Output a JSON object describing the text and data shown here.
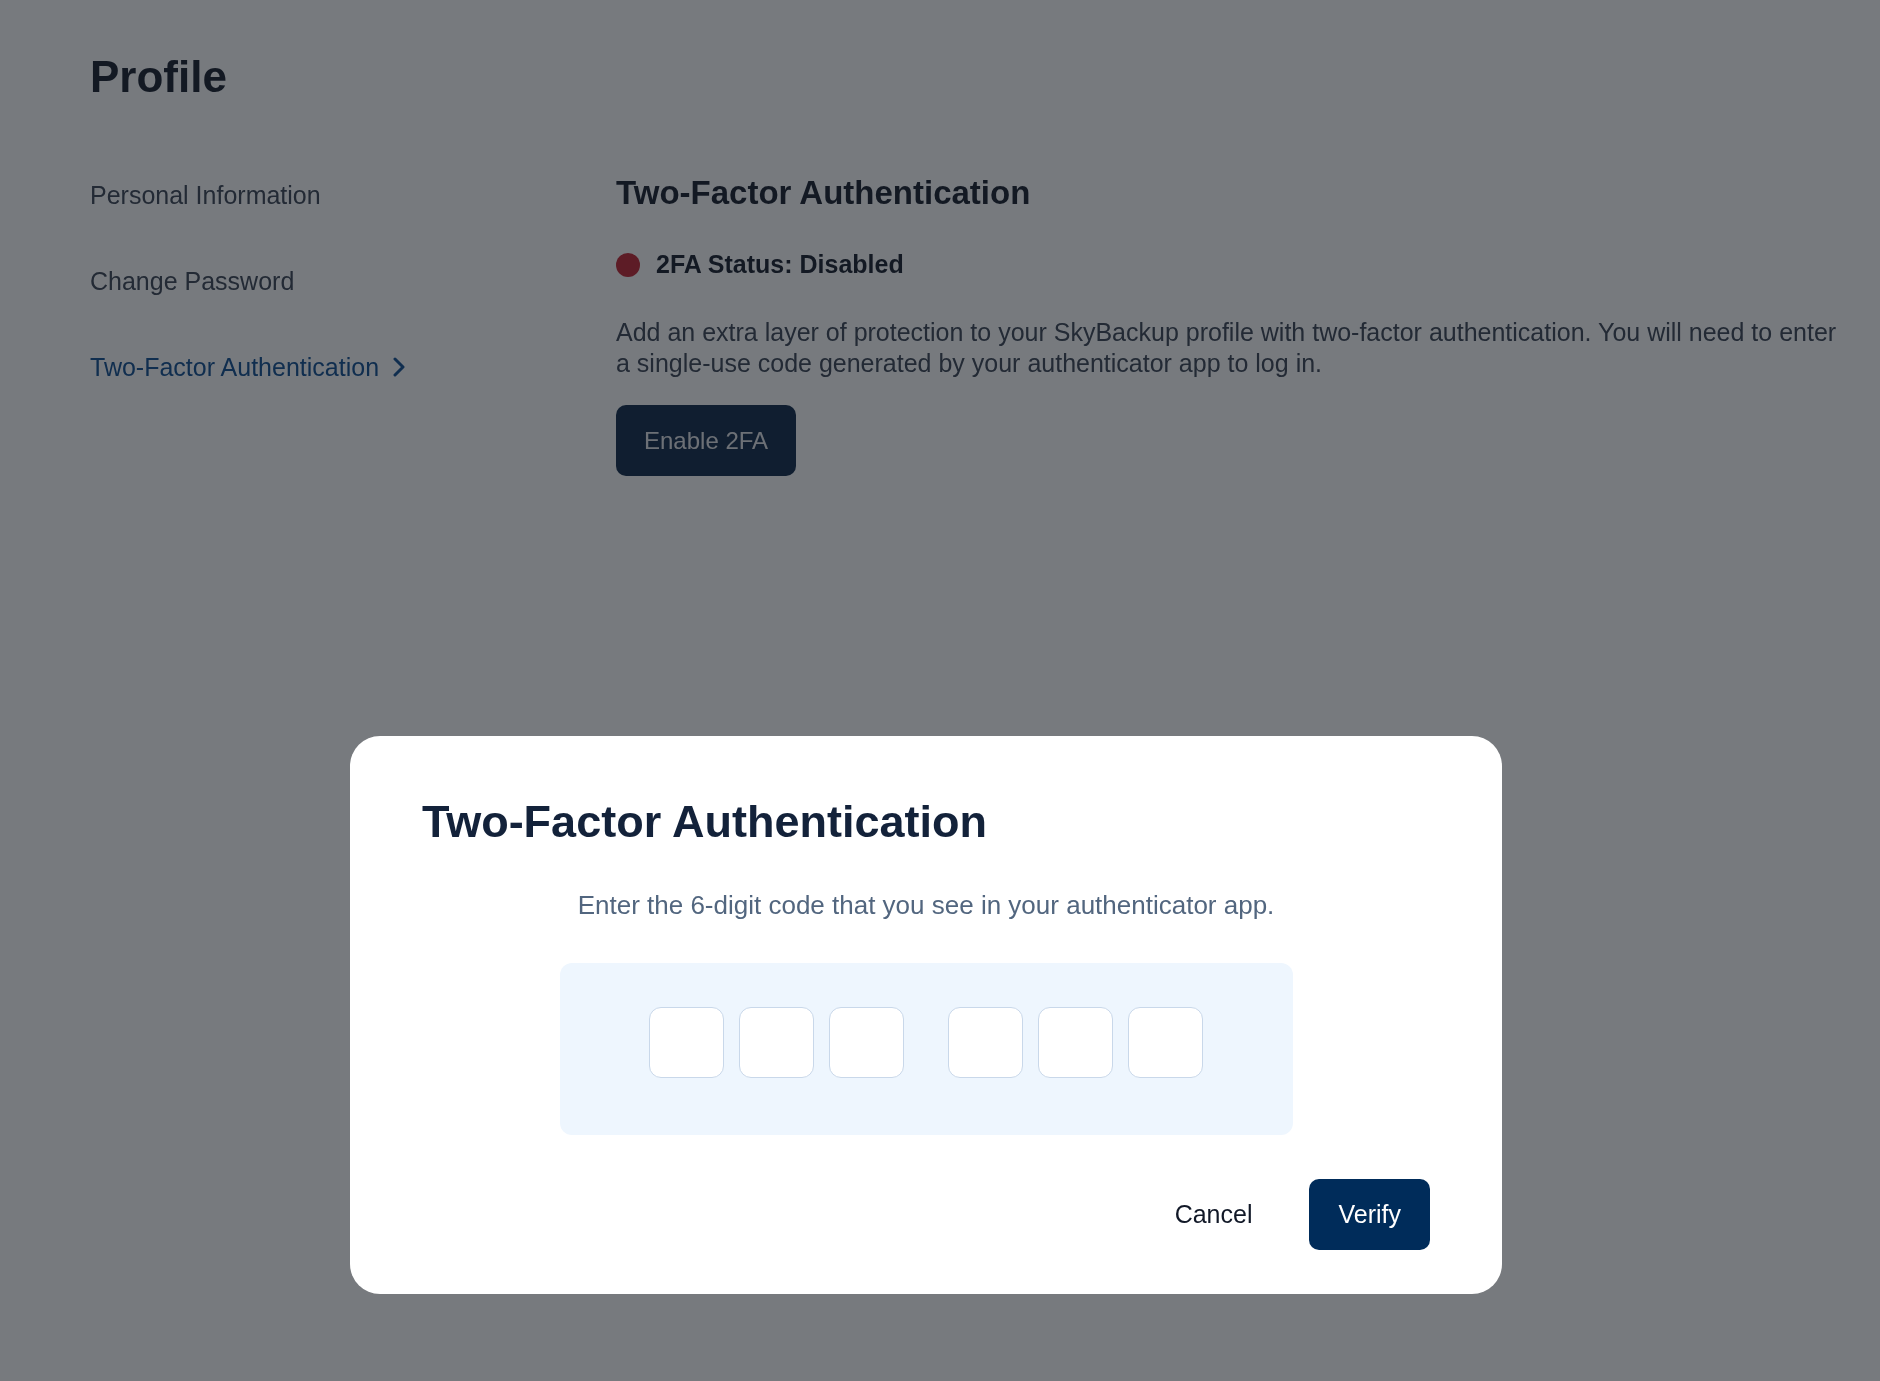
{
  "page": {
    "title": "Profile"
  },
  "sidebar": {
    "items": [
      {
        "label": "Personal Information",
        "selected": false
      },
      {
        "label": "Change Password",
        "selected": false
      },
      {
        "label": "Two-Factor Authentication",
        "selected": true
      }
    ]
  },
  "section": {
    "title": "Two-Factor Authentication",
    "status": {
      "label": "2FA Status: Disabled",
      "enabled": false
    },
    "description": "Add an extra layer of protection to your SkyBackup profile with two-factor authentication. You will need to enter a single-use code generated by your authenticator app to log in.",
    "button": "Enable 2FA"
  },
  "dialog": {
    "title": "Two-Factor Authentication",
    "instruction": "Enter the 6-digit code that you see in your authenticator app.",
    "code_groups": [
      {
        "fields": [
          {
            "filled": false
          },
          {
            "filled": false
          },
          {
            "filled": false
          }
        ]
      },
      {
        "fields": [
          {
            "filled": false
          },
          {
            "filled": false
          },
          {
            "filled": false
          }
        ]
      }
    ],
    "buttons": [
      {
        "label": "Cancel",
        "kind": "text"
      },
      {
        "label": "Verify",
        "kind": "primary"
      }
    ]
  }
}
